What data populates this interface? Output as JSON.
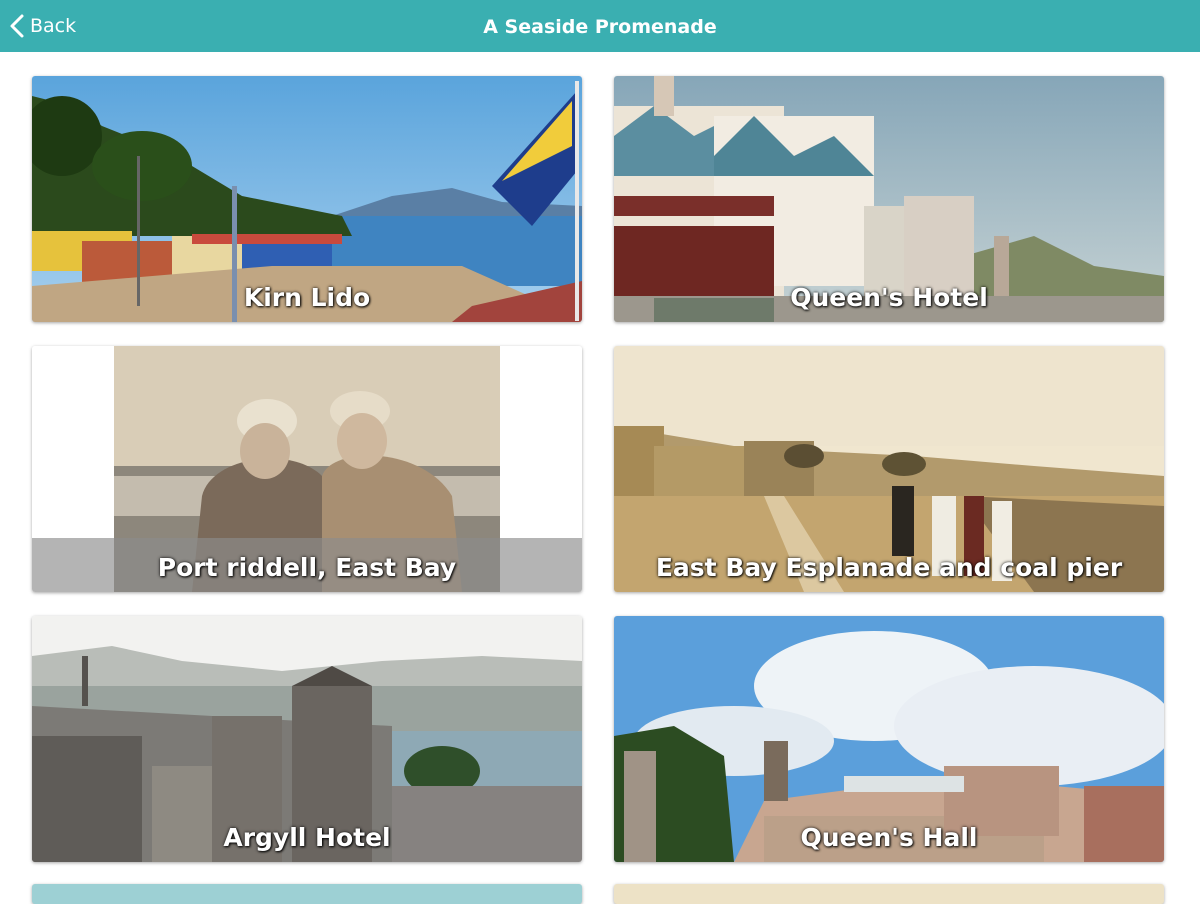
{
  "header": {
    "back_label": "Back",
    "title": "A Seaside Promenade",
    "bar_color": "#3aafb1"
  },
  "cards": [
    {
      "caption": "Kirn Lido"
    },
    {
      "caption": "Queen's Hotel"
    },
    {
      "caption": "Port riddell, East Bay"
    },
    {
      "caption": "East Bay Esplanade and coal pier"
    },
    {
      "caption": "Argyll Hotel"
    },
    {
      "caption": "Queen's Hall"
    }
  ]
}
